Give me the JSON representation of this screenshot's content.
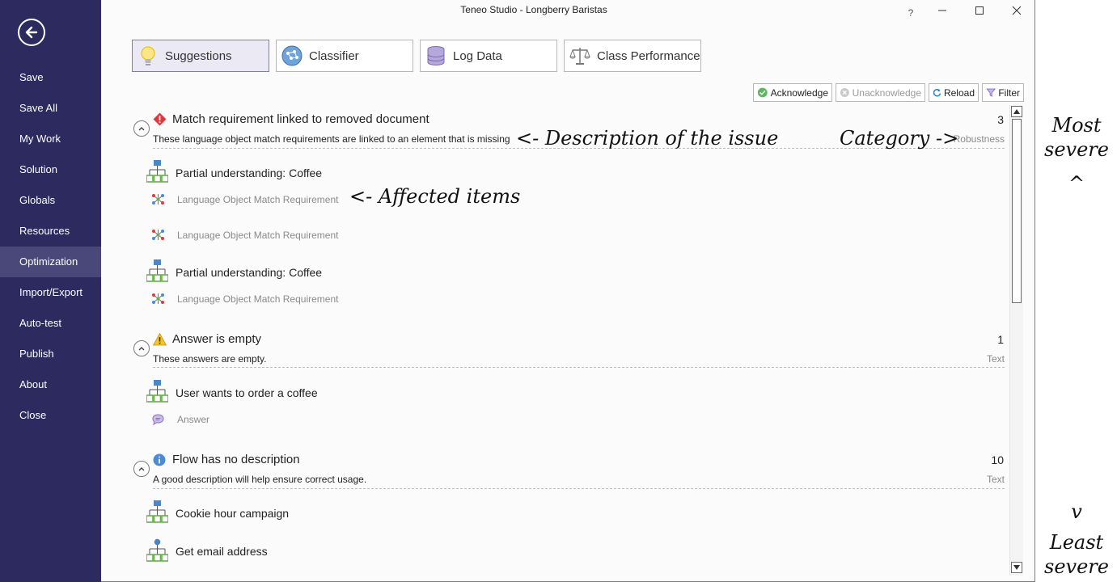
{
  "window": {
    "title": "Teneo Studio - Longberry Baristas",
    "help_label": "?"
  },
  "sidebar": {
    "items": [
      {
        "label": "Save"
      },
      {
        "label": "Save All"
      },
      {
        "label": "My Work"
      },
      {
        "label": "Solution"
      },
      {
        "label": "Globals"
      },
      {
        "label": "Resources"
      },
      {
        "label": "Optimization",
        "active": true
      },
      {
        "label": "Import/Export"
      },
      {
        "label": "Auto-test"
      },
      {
        "label": "Publish"
      },
      {
        "label": "About"
      },
      {
        "label": "Close"
      }
    ]
  },
  "tabs": [
    {
      "label": "Suggestions",
      "icon": "lightbulb-icon",
      "active": true
    },
    {
      "label": "Classifier",
      "icon": "classifier-icon"
    },
    {
      "label": "Log Data",
      "icon": "database-icon"
    },
    {
      "label": "Class Performance",
      "icon": "scales-icon"
    }
  ],
  "toolbar": {
    "acknowledge": "Acknowledge",
    "unacknowledge": "Unacknowledge",
    "reload": "Reload",
    "filter": "Filter"
  },
  "issues": [
    {
      "severity_icon": "error-diamond-icon",
      "title": "Match requirement linked to removed document",
      "count": "3",
      "description": "These language object match requirements are linked to an element that is missing",
      "category": "Robustness",
      "items": [
        {
          "label": "Partial understanding: Coffee",
          "icon": "flow-icon",
          "type": "main"
        },
        {
          "label": "Language Object Match Requirement",
          "icon": "language-object-icon",
          "type": "sub"
        },
        {
          "label": "Language Object Match Requirement",
          "icon": "language-object-icon",
          "type": "sub"
        },
        {
          "label": "Partial understanding: Coffee",
          "icon": "flow-icon",
          "type": "main"
        },
        {
          "label": "Language Object Match Requirement",
          "icon": "language-object-icon",
          "type": "sub"
        }
      ]
    },
    {
      "severity_icon": "warning-triangle-icon",
      "title": "Answer is empty",
      "count": "1",
      "description": "These answers are empty.",
      "category": "Text",
      "items": [
        {
          "label": "User wants to order a coffee",
          "icon": "flow-icon",
          "type": "main"
        },
        {
          "label": "Answer",
          "icon": "speech-bubble-icon",
          "type": "sub"
        }
      ]
    },
    {
      "severity_icon": "info-circle-icon",
      "title": "Flow has no description",
      "count": "10",
      "description": "A good description will help ensure correct usage.",
      "category": "Text",
      "items": [
        {
          "label": "Cookie hour campaign",
          "icon": "flow-icon",
          "type": "main"
        },
        {
          "label": "Get email address",
          "icon": "flow-trigger-icon",
          "type": "main"
        }
      ]
    }
  ],
  "annotations": {
    "description": "<- Description of the issue",
    "category": "Category ->",
    "affected": "<- Affected items",
    "most_severe": "Most severe",
    "least_severe": "Least severe",
    "arrow_up": "^",
    "arrow_down": "v"
  },
  "colors": {
    "sidebar": "#2c2a5e",
    "sidebar_active": "#4a4879",
    "error": "#e0383f",
    "warning": "#f2c12e",
    "info": "#4b8bd6",
    "flow_blue": "#4a86c8",
    "flow_green": "#6ab04c"
  }
}
